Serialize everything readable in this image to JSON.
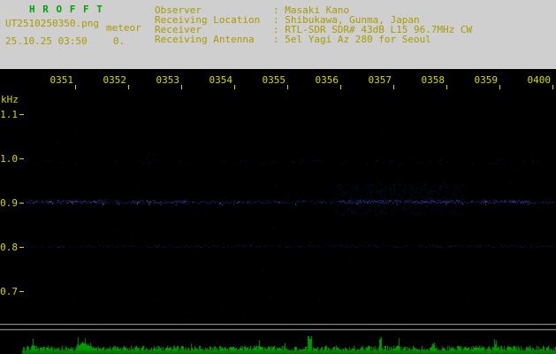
{
  "colors": {
    "header_bg": "#cfcfcf",
    "title_green": "#00a400",
    "header_text_yellow": "#a89a00",
    "axis_yellow": "#d8d800",
    "signal_blue": "#4060e0",
    "level_green": "#00b400",
    "plot_bg": "#000000",
    "separator_gray": "#aaaaaa"
  },
  "header": {
    "app_title": "H R O F F T",
    "filename": "UT2510250350.png",
    "meteor_label": "meteor",
    "datetime": "25.10.25 03:50",
    "counter": "0.",
    "info": [
      {
        "label": "Observer",
        "value": ": Masaki Kano"
      },
      {
        "label": "Receiving Location",
        "value": ": Shibukawa, Gunma, Japan"
      },
      {
        "label": "Receiver",
        "value": ": RTL-SDR SDR# 43dB L15 96.7MHz CW"
      },
      {
        "label": "Receiving Antenna",
        "value": ": 5el Yagi Az 280 for Seoul"
      }
    ]
  },
  "chart_data": {
    "type": "heatmap",
    "title": "",
    "ylabel": "kHz",
    "y_ticks": [
      "1.1",
      "1.0",
      "0.9",
      "0.8",
      "0.7"
    ],
    "ylim": [
      0.65,
      1.15
    ],
    "x_ticks": [
      "0351",
      "0352",
      "0353",
      "0354",
      "0355",
      "0356",
      "0357",
      "0358",
      "0359",
      "0400"
    ],
    "x_range": [
      "0350",
      "0400"
    ],
    "grid": false,
    "legend": false,
    "carrier_bands_khz": [
      0.9,
      0.8
    ],
    "bottom_strip": "signal-level trace (green noise)"
  }
}
